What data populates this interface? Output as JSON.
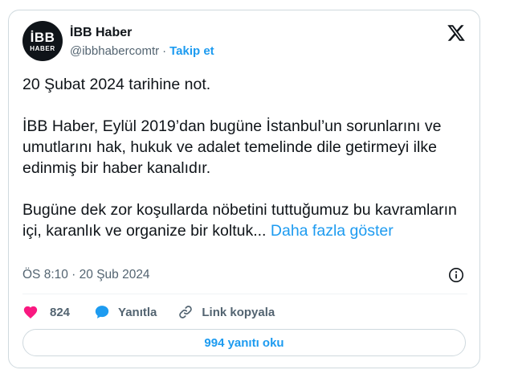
{
  "author": {
    "logo_line1": "İBB",
    "logo_line2": "HABER",
    "name": "İBB Haber",
    "handle": "@ibbhabercomtr",
    "separator": "·",
    "follow_label": "Takip et"
  },
  "tweet": {
    "paragraphs": [
      "20 Şubat 2024 tarihine not.",
      "İBB Haber, Eylül 2019’dan bugüne İstanbul’un sorunlarını ve umutlarını hak, hukuk ve adalet temelinde dile getirmeyi ilke edinmiş bir haber kanalıdır.",
      "Bugüne dek zor koşullarda nöbetini tuttuğumuz bu kavramların içi,  karanlık ve organize bir koltuk..."
    ],
    "show_more_label": "Daha fazla göster",
    "timestamp": "ÖS 8:10 · 20 Şub 2024"
  },
  "actions": {
    "like_count": "824",
    "reply_label": "Yanıtla",
    "copy_link_label": "Link kopyala"
  },
  "replies_button_label": "994 yanıtı oku",
  "colors": {
    "accent": "#1d9bf0",
    "like": "#f91880",
    "text": "#0f1419",
    "secondary": "#536471",
    "border": "#cfd9de"
  },
  "icons": [
    "x-logo-icon",
    "info-icon",
    "heart-icon",
    "reply-bubble-icon",
    "link-icon"
  ]
}
